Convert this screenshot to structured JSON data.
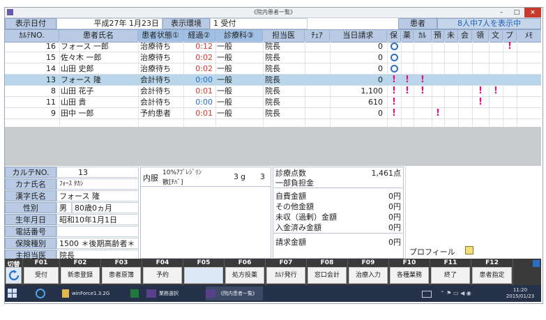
{
  "window": {
    "title": "《院内患者一覧》",
    "minimize": "–",
    "maximize": "□",
    "close": "×"
  },
  "header": {
    "date_label": "表示日付",
    "date_value": "平成27年 1月23日",
    "env_label": "表示環境",
    "env_value": "1 受付",
    "patient_label": "患者",
    "patient_count": "8人中7人を表示中"
  },
  "columns": [
    "ｶﾙﾃNO.",
    "患者氏名",
    "患者状態①",
    "経過②",
    "診療科③",
    "担当医",
    "ﾁｪｱ",
    "当日請求",
    "保",
    "薬",
    "ｶﾙ",
    "預",
    "未",
    "会",
    "領",
    "文",
    "プ",
    "ﾒﾓ"
  ],
  "rows": [
    {
      "no": "16",
      "name": "フォース 一郎",
      "status": "治療待ち",
      "elapsed": "0:12",
      "dept": "一般",
      "doctor": "院長",
      "chair": "",
      "billing": "0",
      "ho": "o",
      "flags": {
        "pu": true
      }
    },
    {
      "no": "15",
      "name": "佐々木 一郎",
      "status": "治療待ち",
      "elapsed": "0:02",
      "dept": "一般",
      "doctor": "院長",
      "chair": "",
      "billing": "0",
      "ho": "o",
      "flags": {}
    },
    {
      "no": "14",
      "name": "山田 史郎",
      "status": "治療待ち",
      "elapsed": "0:02",
      "dept": "一般",
      "doctor": "院長",
      "chair": "",
      "billing": "0",
      "ho": "o",
      "flags": {}
    },
    {
      "no": "13",
      "name": "フォース 隆",
      "status": "会計待ち",
      "elapsed": "0:00",
      "dept": "一般",
      "doctor": "院長",
      "chair": "",
      "billing": "0",
      "ho": "!",
      "flags": {
        "yaku": true,
        "karu": true
      }
    },
    {
      "no": "8",
      "name": "山田 花子",
      "status": "会計待ち",
      "elapsed": "0:01",
      "dept": "一般",
      "doctor": "院長",
      "chair": "",
      "billing": "1,100",
      "ho": "!",
      "flags": {
        "yaku": true,
        "karu": true,
        "ryo": true,
        "bun": true
      }
    },
    {
      "no": "11",
      "name": "山田 貴",
      "status": "会計待ち",
      "elapsed": "0:00",
      "dept": "一般",
      "doctor": "院長",
      "chair": "",
      "billing": "610",
      "ho": "!",
      "flags": {
        "ryo": true
      }
    },
    {
      "no": "9",
      "name": "田中 一郎",
      "status": "予約患者",
      "elapsed": "0:01",
      "dept": "一般",
      "doctor": "院長",
      "chair": "",
      "billing": "0",
      "ho": "!",
      "flags": {
        "azu": true
      }
    }
  ],
  "patient": {
    "no_label": "カルテNO.",
    "no": "13",
    "kana_label": "カナ氏名",
    "kana": "ﾌｫｰｽ ﾀｶｼ",
    "kanji_label": "漢字氏名",
    "kanji": "フォース 隆",
    "sex_label": "性別",
    "sex": "男",
    "age": "80歳0ヵ月",
    "birth_label": "生年月日",
    "birth": "昭和10年1月1日",
    "phone_label": "電話番号",
    "phone": "",
    "insurance_label": "保険種別",
    "insurance": "1500 ＊後期高齢者＊",
    "doctor_label": "主担当医",
    "doctor": "院長"
  },
  "prescription": {
    "type": "内服",
    "drug": "10%ｱﾌﾞﾚｼﾞﾘﾝ",
    "form": "散[ﾁﾊﾞ]",
    "amount": "3",
    "unit": "g",
    "days": "3"
  },
  "billing": [
    {
      "label": "診療点数",
      "value": "1,461点"
    },
    {
      "label": "一部負担金",
      "value": ""
    },
    {
      "label": "自費金額",
      "value": "0円"
    },
    {
      "label": "その他金額",
      "value": "0円"
    },
    {
      "label": "未収（過剰）金額",
      "value": "0円"
    },
    {
      "label": "入金済み金額",
      "value": "0円"
    },
    {
      "label": "請求金額",
      "value": "0円"
    }
  ],
  "profile_label": "プロフィール",
  "fkeys": [
    {
      "key": "切替",
      "label": ""
    },
    {
      "key": "F01",
      "label": "受付"
    },
    {
      "key": "F02",
      "label": "新患登録"
    },
    {
      "key": "F03",
      "label": "患者原簿"
    },
    {
      "key": "F04",
      "label": "予約"
    },
    {
      "key": "F05",
      "label": ""
    },
    {
      "key": "F06",
      "label": "処方投薬"
    },
    {
      "key": "F07",
      "label": "ｶﾙﾃ発行"
    },
    {
      "key": "F08",
      "label": "窓口会計"
    },
    {
      "key": "F09",
      "label": "治療入力"
    },
    {
      "key": "F10",
      "label": "各種業務"
    },
    {
      "key": "F11",
      "label": "終了"
    },
    {
      "key": "F12",
      "label": "患者指定"
    }
  ],
  "taskbar": {
    "items": [
      "winForce1.3.2G",
      "業務選択",
      "《院内患者一覧》"
    ],
    "clock_time": "11:20",
    "clock_date": "2015/01/23"
  },
  "colors": {
    "header_blue": "#b9cbe4",
    "selected_row": "#b9d6ea",
    "alert_pink": "#e2127d",
    "circle_blue": "#2a6ec6",
    "elapsed_red": "#d9342b",
    "elapsed_blue": "#2a6ec6"
  }
}
